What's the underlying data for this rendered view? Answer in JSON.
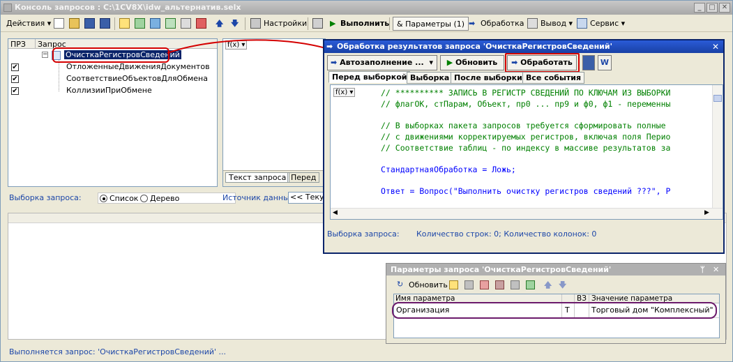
{
  "window": {
    "title": "Консоль запросов : C:\\1CV8X\\idw_альтернатив.selx"
  },
  "toolbar": {
    "actions": "Действия",
    "settings": "Настройки",
    "execute": "Выполнить",
    "params": "Параметры (1)",
    "processing": "Обработка",
    "output": "Вывод",
    "service": "Сервис"
  },
  "tree": {
    "col_prz": "ПРЗ",
    "col_query": "Запрос",
    "root": "ОчисткаРегистровСведений",
    "items": [
      "ОтложенныеДвиженияДокументов",
      "СоответствиеОбъектовДляОбмена",
      "КоллизииПриОбмене"
    ]
  },
  "editor": {
    "fx": "f(x)",
    "tab_query_text": "Текст запроса",
    "tab_before": "Перед"
  },
  "selection": {
    "label": "Выборка запроса:",
    "list": "Список",
    "tree": "Дерево",
    "source_label": "Источник данных:",
    "source_value": "<< Текущ"
  },
  "status": "Выполняется запрос: 'ОчисткаРегистровСведений' ...",
  "proc": {
    "title": "Обработка результатов запроса  'ОчисткаРегистровСведений'",
    "autofill": "Автозаполнение ...",
    "refresh": "Обновить",
    "process": "Обработать",
    "w": "W",
    "tabs": [
      "Перед выборкой",
      "Выборка",
      "После выборки",
      "Все события"
    ],
    "fx": "f(x)",
    "code": [
      "// ********** ЗАПИСЬ В РЕГИСТР СВЕДЕНИЙ ПО КЛЮЧАМ ИЗ ВЫБОРКИ",
      "// флагОК, стПарам, Объект, пр0 ... пр9 и ф0, ф1 - переменны",
      "",
      "// В выборках пакета запросов требуется сформировать полные",
      "// с движениями корректируемых регистров, включая поля Перио",
      "// Соответствие таблиц - по индексу в массиве результатов за",
      "",
      "СтандартнаяОбработка = Ложь;",
      "",
      "Ответ = Вопрос(\"Выполнить очистку регистров сведений ???\", Р"
    ],
    "sel_label": "Выборка запроса:",
    "sel_info": "Количество строк: 0; Количество колонок: 0"
  },
  "params": {
    "title": "Параметры запроса 'ОчисткаРегистровСведений'",
    "refresh": "Обновить",
    "col_name": "Имя параметра",
    "col_vz": "ВЗ",
    "col_value": "Значение параметра",
    "row": {
      "name": "Организация",
      "type": "Т",
      "value": "Торговый дом \"Комплексный\""
    }
  },
  "colors": {
    "highlight_red": "#d40000",
    "highlight_purple": "#6b1a6b",
    "title_blue": "#1941a5"
  }
}
